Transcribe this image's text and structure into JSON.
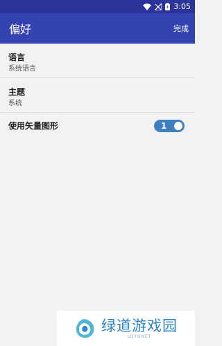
{
  "status_bar": {
    "time": "3:05",
    "icons": [
      "wifi-icon",
      "signal-icon",
      "battery-icon"
    ]
  },
  "app_bar": {
    "title": "偏好",
    "done_label": "完成"
  },
  "settings": [
    {
      "title": "语言",
      "summary": "系统语言"
    },
    {
      "title": "主题",
      "summary": "系统"
    },
    {
      "title": "使用矢量图形",
      "toggle_label": "1",
      "toggle_on": true
    }
  ],
  "watermark": {
    "text": "绿道游戏园",
    "subtext": "LDYGNET"
  },
  "colors": {
    "status_bar": "#2b349a",
    "app_bar": "#3442b2",
    "background": "#f2f2f2",
    "toggle_on": "#3f7fc0",
    "watermark_text": "#2f86c6"
  }
}
